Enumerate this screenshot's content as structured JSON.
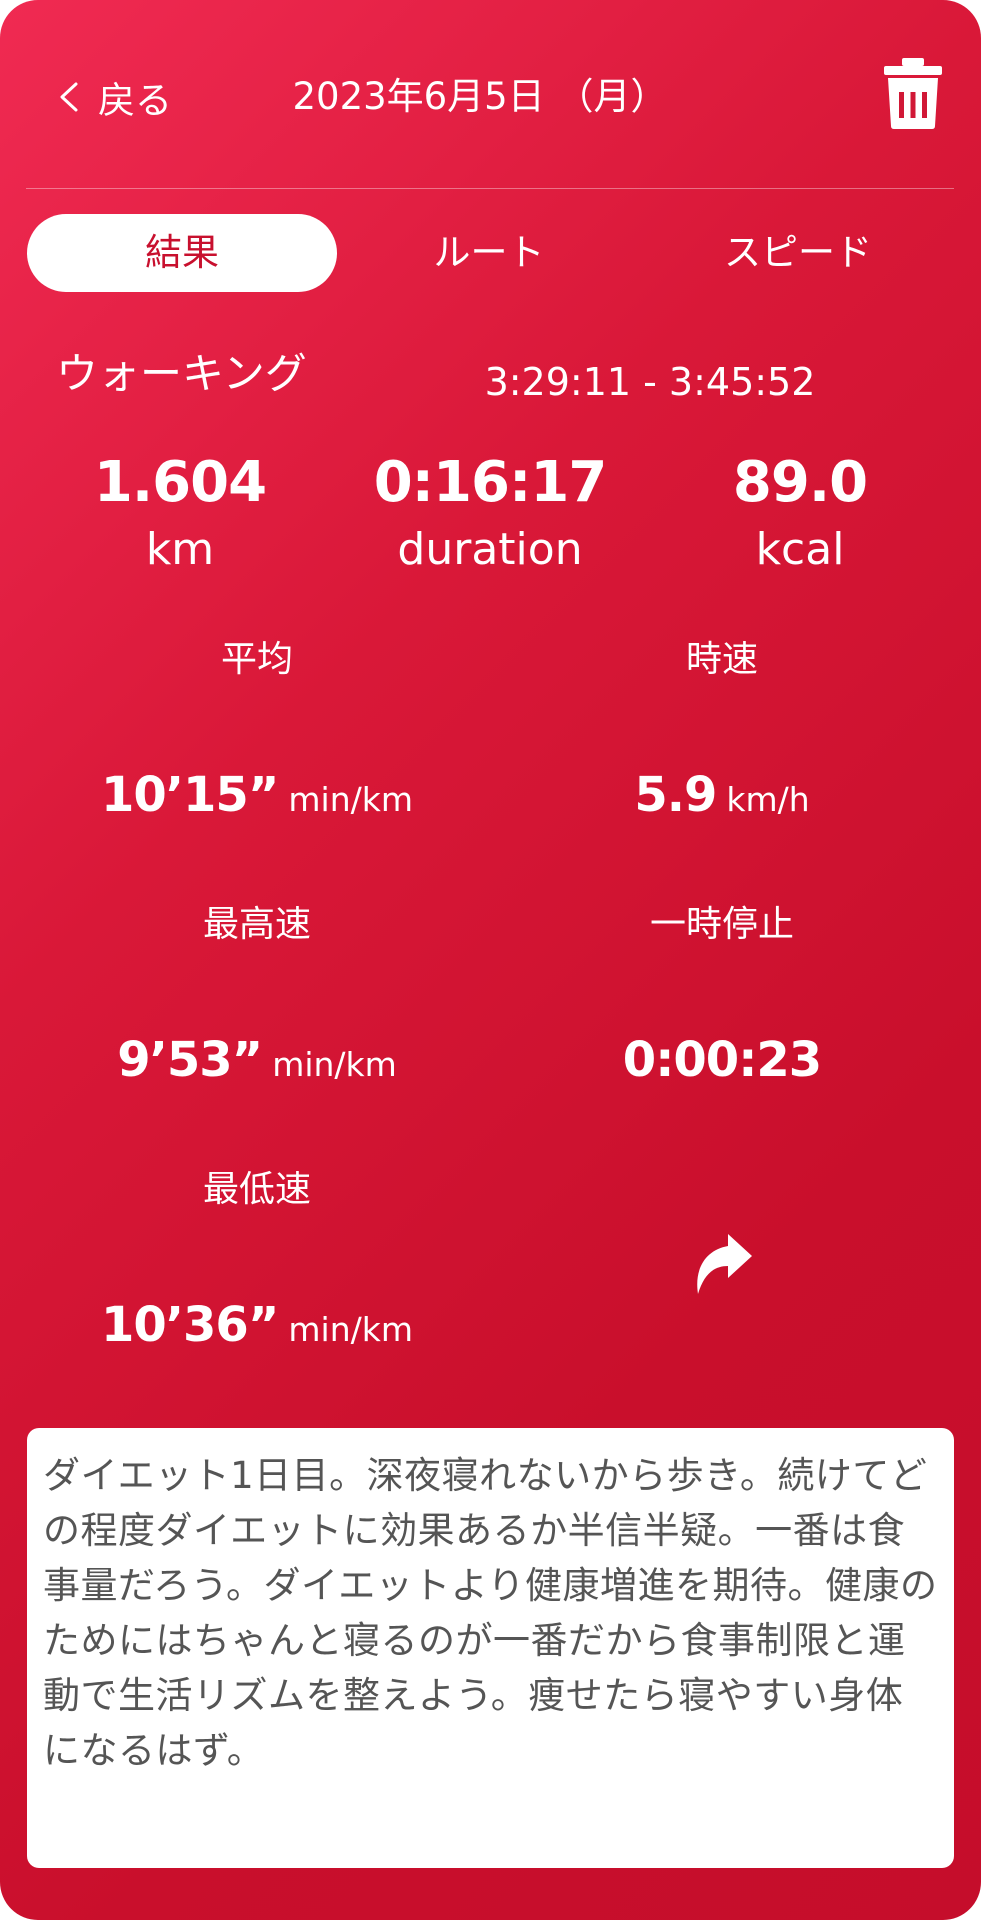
{
  "header": {
    "back_label": "戻る",
    "date": "2023年6月5日 （月）"
  },
  "tabs": [
    {
      "label": "結果",
      "active": true
    },
    {
      "label": "ルート",
      "active": false
    },
    {
      "label": "スピード",
      "active": false
    }
  ],
  "summary": {
    "activity": "ウォーキング",
    "time_range": "3:29:11 - 3:45:52",
    "distance": {
      "value": "1.604",
      "unit": "km"
    },
    "duration": {
      "value": "0:16:17",
      "unit": "duration"
    },
    "calories": {
      "value": "89.0",
      "unit": "kcal"
    }
  },
  "stats": {
    "average_pace": {
      "label": "平均",
      "value": "10’15”",
      "unit": "min/km"
    },
    "speed": {
      "label": "時速",
      "value": "5.9",
      "unit": "km/h"
    },
    "fastest_pace": {
      "label": "最高速",
      "value": "9’53”",
      "unit": "min/km"
    },
    "pause": {
      "label": "一時停止",
      "value": "0:00:23"
    },
    "slowest_pace": {
      "label": "最低速",
      "value": "10’36”",
      "unit": "min/km"
    }
  },
  "memo": "ダイエット1日目。深夜寝れないから歩き。続けてどの程度ダイエットに効果あるか半信半疑。一番は食事量だろう。ダイエットより健康増進を期待。健康のためにはちゃんと寝るのが一番だから食事制限と運動で生活リズムを整えよう。痩せたら寝やすい身体になるはず。",
  "icons": {
    "back": "chevron-left-icon",
    "delete": "trash-icon",
    "share": "share-arrow-icon"
  },
  "colors": {
    "background": "#d2163a",
    "active_tab_text": "#c8102e",
    "memo_background": "#ffffff",
    "memo_text": "#555555"
  }
}
